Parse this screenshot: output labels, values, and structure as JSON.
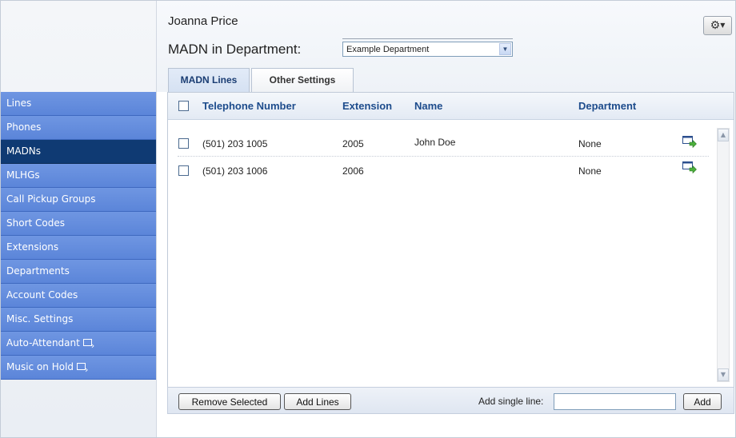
{
  "header": {
    "user_name": "Joanna Price",
    "madn_label": "MADN in Department:",
    "department_select": {
      "value": "Example Department"
    },
    "gear_icon": "gear-icon"
  },
  "tabs": [
    {
      "label": "MADN Lines",
      "active": true
    },
    {
      "label": "Other Settings",
      "active": false
    }
  ],
  "sidebar": {
    "items": [
      {
        "label": "Lines",
        "active": false,
        "external": false
      },
      {
        "label": "Phones",
        "active": false,
        "external": false
      },
      {
        "label": "MADNs",
        "active": true,
        "external": false
      },
      {
        "label": "MLHGs",
        "active": false,
        "external": false
      },
      {
        "label": "Call Pickup Groups",
        "active": false,
        "external": false
      },
      {
        "label": "Short Codes",
        "active": false,
        "external": false
      },
      {
        "label": "Extensions",
        "active": false,
        "external": false
      },
      {
        "label": "Departments",
        "active": false,
        "external": false
      },
      {
        "label": "Account Codes",
        "active": false,
        "external": false
      },
      {
        "label": "Misc. Settings",
        "active": false,
        "external": false
      },
      {
        "label": "Auto-Attendant",
        "active": false,
        "external": true
      },
      {
        "label": "Music on Hold",
        "active": false,
        "external": true
      }
    ]
  },
  "table": {
    "columns": [
      "Telephone Number",
      "Extension",
      "Name",
      "Department"
    ],
    "rows": [
      {
        "telephone": "(501) 203 1005",
        "extension": "2005",
        "name": "John Doe",
        "department": "None"
      },
      {
        "telephone": "(501) 203 1006",
        "extension": "2006",
        "name": "",
        "department": "None"
      }
    ]
  },
  "footer": {
    "remove_selected_label": "Remove Selected",
    "add_lines_label": "Add Lines",
    "add_single_line_label": "Add single line:",
    "add_single_line_value": "",
    "add_label": "Add"
  },
  "colors": {
    "nav_bg": "#5b85d9",
    "nav_active": "#0f3a73",
    "header_text": "#1d4c8c"
  }
}
